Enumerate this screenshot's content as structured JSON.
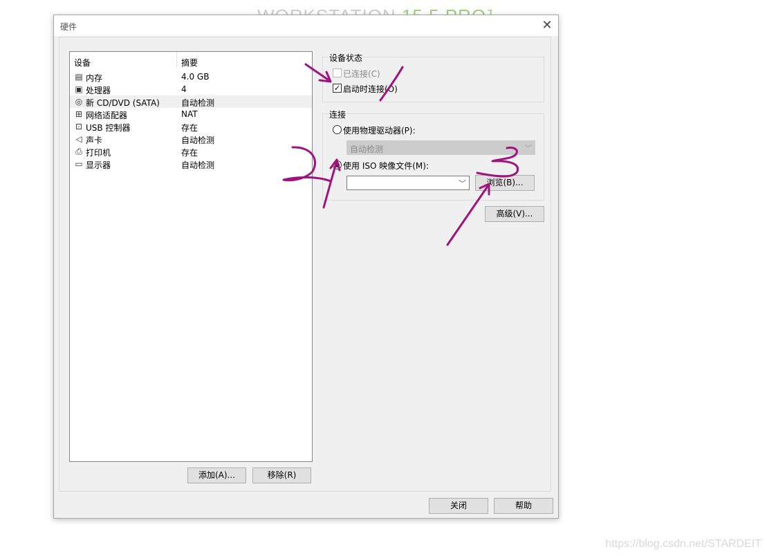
{
  "background": {
    "banner_text": "WORKSTATION",
    "banner_version": "15.5 PRO",
    "banner_tm": "™",
    "watermark": "https://blog.csdn.net/STARDEIT"
  },
  "dialog": {
    "title": "硬件",
    "close_glyph": "✕"
  },
  "device_list": {
    "col_device": "设备",
    "col_summary": "摘要",
    "rows": [
      {
        "icon": "memory-icon",
        "name": "内存",
        "summary": "4.0 GB"
      },
      {
        "icon": "processor-icon",
        "name": "处理器",
        "summary": "4"
      },
      {
        "icon": "cd-dvd-icon",
        "name": "新 CD/DVD (SATA)",
        "summary": "自动检测",
        "selected": true
      },
      {
        "icon": "network-adapter-icon",
        "name": "网络适配器",
        "summary": "NAT"
      },
      {
        "icon": "usb-controller-icon",
        "name": "USB 控制器",
        "summary": "存在"
      },
      {
        "icon": "sound-card-icon",
        "name": "声卡",
        "summary": "自动检测"
      },
      {
        "icon": "printer-icon",
        "name": "打印机",
        "summary": "存在"
      },
      {
        "icon": "display-icon",
        "name": "显示器",
        "summary": "自动检测"
      }
    ],
    "add_button": "添加(A)...",
    "remove_button": "移除(R)"
  },
  "device_status": {
    "legend": "设备状态",
    "connected": {
      "label": "已连接(C)",
      "checked": false,
      "enabled": false
    },
    "connect_at_power_on": {
      "label": "启动时连接(O)",
      "checked": true,
      "enabled": true
    }
  },
  "connection": {
    "legend": "连接",
    "physical_drive": {
      "label": "使用物理驱动器(P):",
      "selected": false
    },
    "physical_drive_select": {
      "value": "自动检测",
      "enabled": false
    },
    "iso_image": {
      "label": "使用 ISO 映像文件(M):",
      "selected": true
    },
    "iso_path": {
      "value": ""
    },
    "browse_button": "浏览(B)..."
  },
  "advanced_button": "高级(V)...",
  "footer": {
    "close_button": "关闭",
    "help_button": "帮助"
  },
  "colors": {
    "annotation": "#a0127e",
    "dialog_bg": "#f0f0f0",
    "button_bg": "#e1e1e1"
  }
}
